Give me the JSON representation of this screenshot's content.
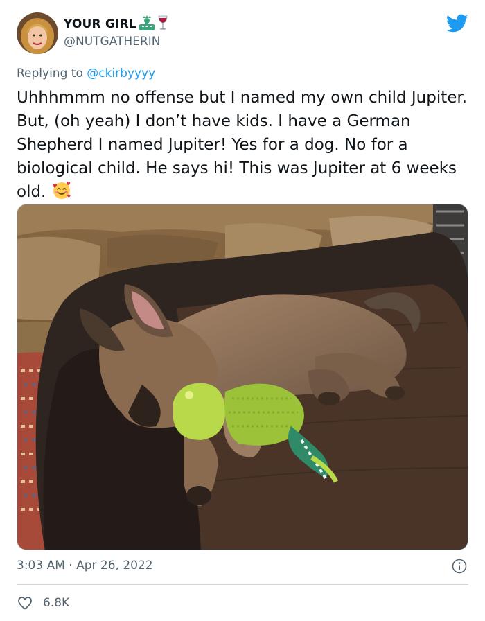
{
  "author": {
    "display_name": "YOUR GIRL",
    "handle": "@NUTGATHERIN",
    "name_emojis": [
      "statue-of-liberty-emoji",
      "wine-glass-emoji"
    ]
  },
  "reply": {
    "prefix": "Replying to ",
    "mention": "@ckirbyyyy"
  },
  "tweet": {
    "text": "Uhhhmmm no offense but I named my own child Jupiter. But, (oh yeah) I don’t have kids. I have a German Shepherd I named Jupiter! Yes for a dog. No for a biological child. He says hi! This was Jupiter at 6 weeks old. ",
    "trailing_emoji": "smiling-face-with-hearts-emoji"
  },
  "footer": {
    "timestamp": "3:03 AM · Apr 26, 2022",
    "like_count": "6.8K"
  },
  "icons": {
    "brand": "twitter-bird-icon",
    "info": "info-icon",
    "like": "heart-icon"
  },
  "colors": {
    "brand": "#1d9bf0",
    "text_primary": "#0f1419",
    "text_secondary": "#536471",
    "divider": "#cfd9de"
  }
}
